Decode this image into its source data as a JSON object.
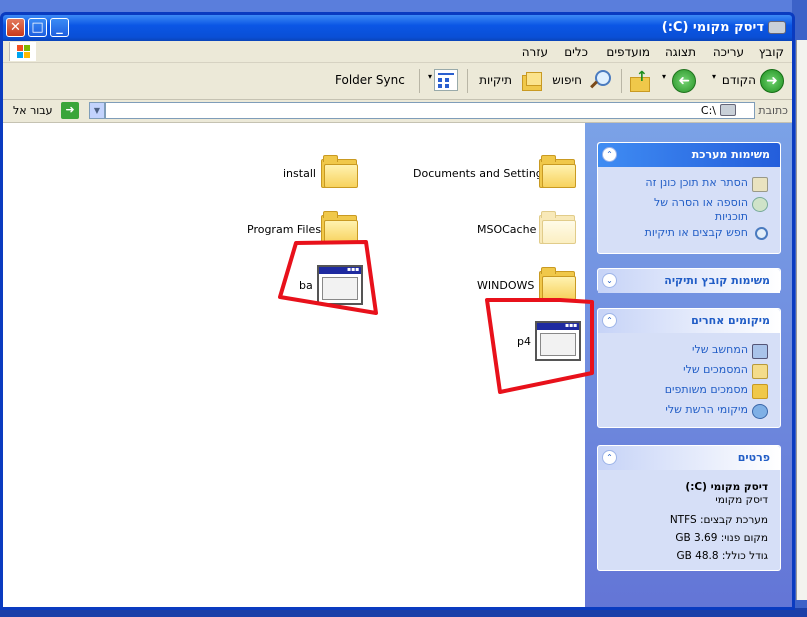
{
  "window": {
    "title": "דיסק מקומי (C:)",
    "buttons": {
      "close": "✕",
      "max": "□",
      "min": "_"
    }
  },
  "menu": [
    "קובץ",
    "עריכה",
    "תצוגה",
    "מועדפים",
    "כלים",
    "עזרה"
  ],
  "toolbar": {
    "back": "הקודם",
    "search": "חיפוש",
    "folders": "תיקיות",
    "folder_sync": "Folder Sync"
  },
  "address": {
    "label": "כתובת",
    "value": "C:\\",
    "go": "עבור אל"
  },
  "files": [
    {
      "name": "Documents and Settings",
      "kind": "folder"
    },
    {
      "name": "install",
      "kind": "folder"
    },
    {
      "name": "MSOCache",
      "kind": "folder-hidden"
    },
    {
      "name": "Program Files",
      "kind": "folder"
    },
    {
      "name": "WINDOWS",
      "kind": "folder"
    },
    {
      "name": "ba",
      "kind": "app"
    },
    {
      "name": "p4",
      "kind": "app"
    }
  ],
  "taskpane": {
    "system": {
      "title": "משימות מערכת",
      "links": [
        "הסתר את תוכן כונן זה",
        "הוספה או הסרה של",
        "תוכניות",
        "חפש קבצים או תיקיות"
      ]
    },
    "filefolder": {
      "title": "משימות קובץ ותיקיה"
    },
    "places": {
      "title": "מיקומים אחרים",
      "links": [
        "המחשב שלי",
        "המסמכים שלי",
        "מסמכים משותפים",
        "מיקומי הרשת שלי"
      ]
    },
    "details": {
      "title": "פרטים",
      "name": "דיסק מקומי (C:)",
      "type": "דיסק מקומי",
      "fs": "מערכת קבצים: NTFS",
      "free": "מקום פנוי: 3.69 GB",
      "total": "גודל כולל: 48.8 GB"
    }
  },
  "colors": {
    "titlebar": "#0b56e5",
    "taskpane": "#6f8fe0",
    "link": "#215dc6",
    "annotation": "#e8111b"
  },
  "icons": {
    "chevron_up": "⌃",
    "chevron_down": "⌄"
  }
}
